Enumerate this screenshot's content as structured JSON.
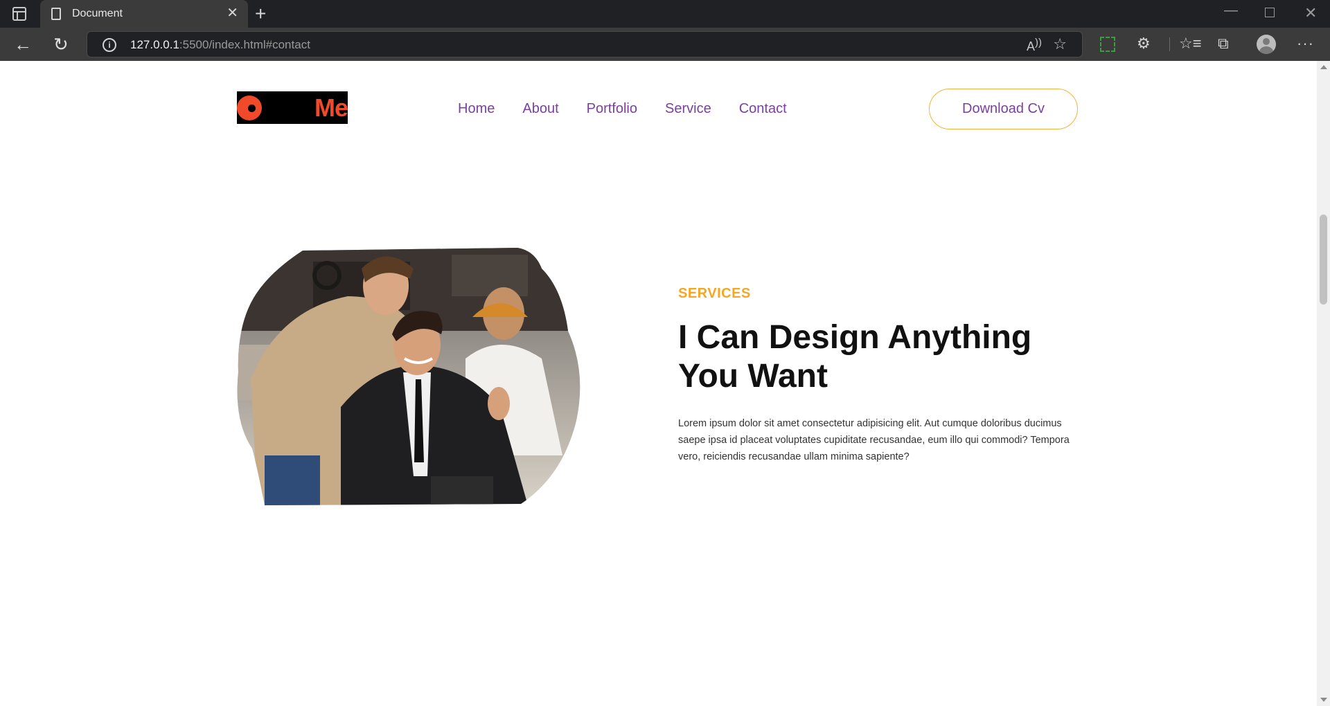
{
  "browser": {
    "tab_title": "Document",
    "url_host": "127.0.0.1",
    "url_rest": ":5500/index.html#contact"
  },
  "icons": {
    "back": "back-arrow-icon",
    "reload": "reload-icon",
    "info": "info-icon",
    "read_aloud": "read-aloud-icon",
    "favorite": "add-favorite-icon",
    "extensions": "extensions-icon",
    "favorites": "favorites-icon",
    "collections": "collections-icon",
    "profile": "profile-icon",
    "more": "more-icon"
  },
  "site": {
    "logo_text": "Me",
    "nav": [
      "Home",
      "About",
      "Portfolio",
      "Service",
      "Contact"
    ],
    "cta": "Download Cv"
  },
  "services": {
    "eyebrow": "SERVICES",
    "headline": "I Can Design Anything You Want",
    "body": "Lorem ipsum dolor sit amet consectetur adipisicing elit. Aut cumque doloribus ducimus saepe ipsa id placeat voluptates cupiditate recusandae, eum illo qui commodi? Tempora vero, reiciendis recusandae ullam minima sapiente?"
  },
  "colors": {
    "accent_orange": "#f5a623",
    "nav_purple": "#7b3fa0",
    "logo_red": "#f04a2a"
  }
}
